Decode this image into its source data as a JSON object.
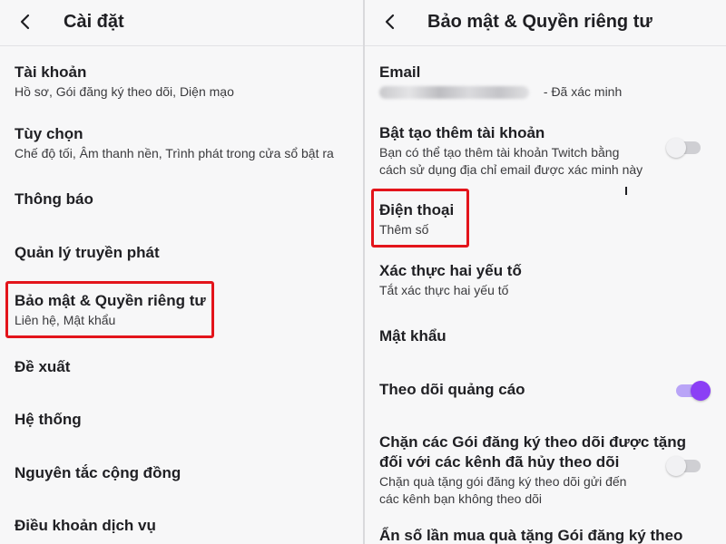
{
  "left_screen": {
    "title": "Cài đặt",
    "items": [
      {
        "title": "Tài khoản",
        "subtitle": "Hồ sơ, Gói đăng ký theo dõi, Diện mạo"
      },
      {
        "title": "Tùy chọn",
        "subtitle": "Chế độ tối, Âm thanh nền, Trình phát trong cửa sổ bật ra"
      },
      {
        "title": "Thông báo"
      },
      {
        "title": "Quản lý truyền phát"
      },
      {
        "title": "Bảo mật & Quyền riêng tư",
        "subtitle": "Liên hệ, Mật khẩu",
        "highlighted": true
      },
      {
        "title": "Đề xuất"
      },
      {
        "title": "Hệ thống"
      },
      {
        "title": "Nguyên tắc cộng đồng"
      },
      {
        "title": "Điều khoản dịch vụ"
      }
    ]
  },
  "right_screen": {
    "title": "Bảo mật & Quyền riêng tư",
    "email": {
      "title": "Email",
      "status": "- Đã xác minh"
    },
    "multi_account": {
      "title": "Bật tạo thêm tài khoản",
      "description": [
        "Bạn có thể tạo thêm tài khoản Twitch bằng",
        "cách sử dụng địa chỉ email được xác minh này"
      ],
      "enabled": false
    },
    "phone": {
      "title": "Điện thoại",
      "subtitle": "Thêm số",
      "highlighted": true
    },
    "two_factor": {
      "title": "Xác thực hai yếu tố",
      "subtitle": "Tắt xác thực hai yếu tố"
    },
    "password": {
      "title": "Mật khẩu"
    },
    "ad_tracking": {
      "title": "Theo dõi quảng cáo",
      "enabled": true
    },
    "block_gifts": {
      "title": [
        "Chặn các Gói đăng ký theo dõi được tặng",
        "đối với các kênh đã hủy theo dõi"
      ],
      "description": [
        "Chặn quà tặng gói đăng ký theo dõi gửi đến",
        "các kênh bạn không theo dõi"
      ],
      "enabled": false
    },
    "hide_gift_count": {
      "title": "Ẩn số lần mua quà tặng Gói đăng ký theo"
    }
  },
  "colors": {
    "highlight": "#e3141b",
    "toggle_on": "#8b3ff5",
    "background": "#f7f7f8"
  },
  "icons": {
    "back": "chevron-left-icon"
  }
}
